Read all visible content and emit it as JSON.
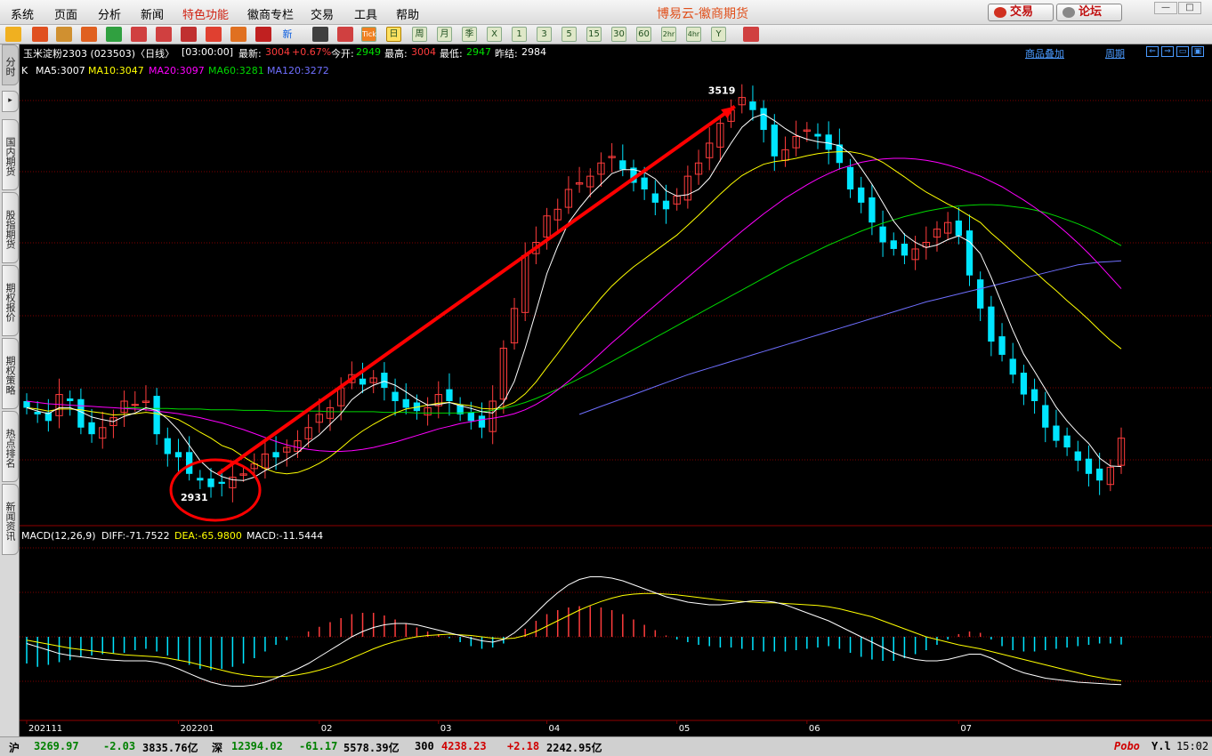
{
  "menu": {
    "items": [
      "系统",
      "页面",
      "分析",
      "新闻",
      "特色功能",
      "徽商专栏",
      "交易",
      "工具",
      "帮助"
    ],
    "app_title": "博易云-徽商期货",
    "trade_btn": "交易",
    "forum_btn": "论坛"
  },
  "toolbar": {
    "periods": [
      "日",
      "周",
      "月",
      "季",
      "X",
      "1",
      "3",
      "5",
      "15",
      "30",
      "60",
      "2hr",
      "4hr",
      "Y"
    ],
    "new_label": "新",
    "tick_label": "Tick"
  },
  "sidebar": {
    "tabs": [
      "分时",
      "国内期货",
      "股指期货",
      "期权报价",
      "期权策略",
      "热点排名",
      "新闻资讯"
    ]
  },
  "info": {
    "title": "玉米淀粉2303 (023503)〈日线〉",
    "time": "[03:00:00]",
    "latest_label": "最新:",
    "latest": "3004",
    "change": "+0.67%",
    "open_label": "今开:",
    "open": "2949",
    "high_label": "最高:",
    "high": "3004",
    "low_label": "最低:",
    "low": "2947",
    "prev_label": "昨结:",
    "prev": "2984",
    "overlay_link": "商品叠加",
    "period_link": "周期"
  },
  "ma_legend": {
    "k": "K",
    "ma5": "MA5:3007",
    "ma10": "MA10:3047",
    "ma20": "MA20:3097",
    "ma60": "MA60:3281",
    "ma120": "MA120:3272"
  },
  "macd_legend": {
    "name": "MACD(12,26,9)",
    "diff": "DIFF:-71.7522",
    "dea": "DEA:-65.9800",
    "macd": "MACD:-11.5444"
  },
  "annotations": {
    "high_label": "3519",
    "low_label": "2931"
  },
  "xaxis": {
    "labels": [
      "202111",
      "202201",
      "02",
      "03",
      "04",
      "05",
      "06",
      "07"
    ]
  },
  "colors": {
    "up": "#ff3c3c",
    "down": "#00e5ff",
    "ma5": "#ffffff",
    "ma10": "#ffff00",
    "ma20": "#ff00ff",
    "ma60": "#00d800",
    "ma120": "#6f6fff",
    "grid": "#800000",
    "arrow": "#ff0000"
  },
  "chart_data": {
    "type": "candlestick",
    "ylim": [
      2900,
      3540
    ],
    "closes": [
      3050,
      3040,
      3030,
      3070,
      3060,
      3020,
      3010,
      3020,
      3035,
      3060,
      3055,
      3060,
      3010,
      2980,
      2975,
      2950,
      2940,
      2930,
      2935,
      2945,
      2950,
      2965,
      2980,
      2975,
      2990,
      3000,
      3020,
      3040,
      3050,
      3080,
      3100,
      3085,
      3095,
      3080,
      3060,
      3050,
      3045,
      3050,
      3070,
      3060,
      3040,
      3030,
      3020,
      3060,
      3140,
      3200,
      3280,
      3300,
      3340,
      3350,
      3380,
      3390,
      3400,
      3420,
      3430,
      3410,
      3390,
      3380,
      3360,
      3350,
      3370,
      3400,
      3420,
      3450,
      3480,
      3500,
      3519,
      3500,
      3470,
      3430,
      3440,
      3460,
      3470,
      3460,
      3440,
      3420,
      3380,
      3360,
      3330,
      3300,
      3290,
      3280,
      3290,
      3300,
      3320,
      3330,
      3310,
      3250,
      3200,
      3150,
      3130,
      3100,
      3070,
      3060,
      3020,
      3000,
      2990,
      2970,
      2950,
      2940,
      2960,
      3004
    ],
    "ma5": [
      3050,
      3045,
      3041,
      3050,
      3050,
      3044,
      3036,
      3032,
      3029,
      3037,
      3042,
      3050,
      3046,
      3033,
      3016,
      2993,
      2970,
      2955,
      2946,
      2941,
      2940,
      2945,
      2955,
      2963,
      2972,
      2982,
      2997,
      3009,
      3025,
      3041,
      3062,
      3075,
      3084,
      3090,
      3084,
      3074,
      3063,
      3054,
      3055,
      3058,
      3053,
      3049,
      3044,
      3042,
      3058,
      3090,
      3140,
      3196,
      3253,
      3294,
      3330,
      3352,
      3372,
      3388,
      3404,
      3410,
      3410,
      3406,
      3396,
      3378,
      3370,
      3372,
      3380,
      3397,
      3424,
      3450,
      3474,
      3488,
      3494,
      3484,
      3472,
      3462,
      3456,
      3452,
      3450,
      3446,
      3434,
      3412,
      3388,
      3360,
      3332,
      3312,
      3300,
      3292,
      3296,
      3304,
      3310,
      3301,
      3283,
      3247,
      3207,
      3167,
      3131,
      3105,
      3078,
      3051,
      3030,
      3012,
      2996,
      2974,
      2962,
      2961
    ],
    "ma10": [
      3050,
      3048,
      3045,
      3048,
      3048,
      3047,
      3044,
      3042,
      3039,
      3040,
      3041,
      3043,
      3041,
      3037,
      3032,
      3023,
      3013,
      3004,
      2993,
      2987,
      2976,
      2966,
      2958,
      2952,
      2950,
      2952,
      2958,
      2966,
      2976,
      2989,
      3003,
      3015,
      3025,
      3034,
      3042,
      3048,
      3051,
      3054,
      3057,
      3058,
      3055,
      3053,
      3049,
      3048,
      3051,
      3058,
      3071,
      3089,
      3111,
      3132,
      3154,
      3176,
      3196,
      3216,
      3234,
      3249,
      3263,
      3275,
      3287,
      3299,
      3311,
      3326,
      3341,
      3357,
      3373,
      3388,
      3401,
      3410,
      3418,
      3422,
      3424,
      3427,
      3431,
      3434,
      3436,
      3437,
      3437,
      3434,
      3429,
      3421,
      3410,
      3399,
      3387,
      3376,
      3367,
      3358,
      3350,
      3340,
      3330,
      3314,
      3300,
      3285,
      3270,
      3256,
      3241,
      3227,
      3212,
      3198,
      3183,
      3167,
      3152,
      3139
    ],
    "ma20": [
      3060,
      3058,
      3056,
      3055,
      3054,
      3053,
      3052,
      3051,
      3050,
      3049,
      3048,
      3047,
      3045,
      3043,
      3041,
      3038,
      3035,
      3031,
      3027,
      3022,
      3017,
      3011,
      3005,
      2999,
      2994,
      2990,
      2987,
      2985,
      2984,
      2984,
      2985,
      2987,
      2990,
      2994,
      2998,
      3003,
      3008,
      3013,
      3018,
      3022,
      3026,
      3029,
      3032,
      3034,
      3037,
      3041,
      3047,
      3055,
      3065,
      3077,
      3090,
      3104,
      3118,
      3133,
      3148,
      3162,
      3177,
      3191,
      3205,
      3219,
      3233,
      3247,
      3261,
      3275,
      3289,
      3303,
      3317,
      3330,
      3343,
      3355,
      3367,
      3377,
      3387,
      3396,
      3404,
      3411,
      3416,
      3421,
      3424,
      3426,
      3427,
      3427,
      3426,
      3424,
      3421,
      3417,
      3412,
      3406,
      3400,
      3392,
      3384,
      3374,
      3364,
      3353,
      3341,
      3328,
      3314,
      3299,
      3283,
      3266,
      3248,
      3230
    ],
    "ma60": [
      null,
      null,
      null,
      null,
      null,
      null,
      null,
      null,
      null,
      3050,
      3050,
      3049,
      3049,
      3049,
      3048,
      3048,
      3048,
      3047,
      3047,
      3047,
      3046,
      3046,
      3046,
      3045,
      3045,
      3045,
      3045,
      3045,
      3044,
      3044,
      3044,
      3044,
      3044,
      3043,
      3043,
      3043,
      3042,
      3042,
      3042,
      3042,
      3042,
      3043,
      3044,
      3046,
      3049,
      3053,
      3058,
      3064,
      3071,
      3078,
      3086,
      3094,
      3102,
      3111,
      3120,
      3129,
      3138,
      3147,
      3156,
      3165,
      3174,
      3183,
      3192,
      3201,
      3210,
      3219,
      3228,
      3237,
      3246,
      3255,
      3264,
      3272,
      3280,
      3288,
      3296,
      3303,
      3310,
      3317,
      3323,
      3329,
      3334,
      3339,
      3343,
      3347,
      3350,
      3353,
      3355,
      3356,
      3357,
      3357,
      3356,
      3354,
      3352,
      3349,
      3345,
      3340,
      3334,
      3328,
      3321,
      3313,
      3304,
      3295
    ],
    "ma120": [
      null,
      null,
      null,
      null,
      null,
      null,
      null,
      null,
      null,
      null,
      null,
      null,
      null,
      null,
      null,
      null,
      null,
      null,
      null,
      null,
      null,
      null,
      null,
      null,
      null,
      null,
      null,
      null,
      null,
      null,
      null,
      null,
      null,
      null,
      null,
      null,
      null,
      null,
      null,
      null,
      null,
      null,
      null,
      null,
      null,
      null,
      null,
      null,
      null,
      null,
      null,
      3040,
      3046,
      3052,
      3058,
      3064,
      3070,
      3076,
      3082,
      3088,
      3094,
      3100,
      3105,
      3110,
      3115,
      3120,
      3125,
      3130,
      3135,
      3140,
      3145,
      3150,
      3155,
      3160,
      3165,
      3170,
      3175,
      3180,
      3185,
      3190,
      3195,
      3200,
      3205,
      3210,
      3214,
      3218,
      3222,
      3226,
      3230,
      3234,
      3238,
      3242,
      3246,
      3250,
      3254,
      3258,
      3262,
      3266,
      3268,
      3270,
      3271,
      3272
    ],
    "macd_hist": [
      -40,
      -45,
      -42,
      -38,
      -35,
      -30,
      -28,
      -26,
      -25,
      -24,
      -20,
      -18,
      -22,
      -28,
      -35,
      -42,
      -48,
      -50,
      -48,
      -45,
      -40,
      -32,
      -22,
      -12,
      -5,
      0,
      8,
      15,
      22,
      28,
      34,
      36,
      36,
      32,
      26,
      20,
      14,
      8,
      4,
      -2,
      -8,
      -14,
      -18,
      -16,
      -10,
      0,
      12,
      24,
      34,
      40,
      44,
      46,
      46,
      44,
      40,
      34,
      26,
      18,
      10,
      2,
      -4,
      -8,
      -12,
      -14,
      -16,
      -16,
      -18,
      -20,
      -22,
      -22,
      -22,
      -20,
      -18,
      -16,
      -14,
      -18,
      -24,
      -30,
      -34,
      -36,
      -36,
      -32,
      -26,
      -20,
      -12,
      -4,
      4,
      8,
      6,
      -4,
      -14,
      -20,
      -22,
      -22,
      -20,
      -18,
      -16,
      -14,
      -12,
      -10,
      -10,
      -11.5444
    ],
    "diff": [
      -10,
      -15,
      -20,
      -25,
      -28,
      -30,
      -32,
      -34,
      -35,
      -36,
      -36,
      -36,
      -38,
      -42,
      -48,
      -55,
      -62,
      -68,
      -72,
      -74,
      -74,
      -72,
      -68,
      -62,
      -55,
      -48,
      -40,
      -30,
      -20,
      -10,
      0,
      8,
      14,
      18,
      20,
      20,
      18,
      14,
      10,
      6,
      2,
      -2,
      -6,
      -8,
      -4,
      6,
      20,
      36,
      52,
      66,
      78,
      86,
      90,
      90,
      88,
      84,
      78,
      72,
      66,
      60,
      56,
      52,
      50,
      48,
      48,
      50,
      52,
      54,
      54,
      52,
      48,
      42,
      36,
      30,
      24,
      16,
      8,
      0,
      -8,
      -16,
      -24,
      -30,
      -34,
      -36,
      -36,
      -34,
      -30,
      -26,
      -26,
      -32,
      -40,
      -48,
      -54,
      -58,
      -62,
      -64,
      -66,
      -68,
      -69,
      -70,
      -71,
      -71.7522
    ],
    "dea": [
      -5,
      -8,
      -11,
      -14,
      -17,
      -19,
      -21,
      -23,
      -25,
      -27,
      -28,
      -29,
      -30,
      -32,
      -35,
      -38,
      -42,
      -46,
      -50,
      -54,
      -57,
      -59,
      -60,
      -60,
      -59,
      -57,
      -54,
      -50,
      -45,
      -39,
      -32,
      -25,
      -18,
      -12,
      -7,
      -3,
      0,
      2,
      3,
      4,
      3,
      2,
      0,
      -2,
      -3,
      -2,
      2,
      8,
      16,
      24,
      32,
      40,
      47,
      53,
      58,
      62,
      64,
      65,
      65,
      64,
      63,
      61,
      59,
      57,
      55,
      54,
      53,
      52,
      51,
      51,
      50,
      49,
      48,
      47,
      45,
      42,
      38,
      34,
      30,
      24,
      18,
      12,
      6,
      0,
      -4,
      -8,
      -12,
      -15,
      -18,
      -22,
      -26,
      -30,
      -34,
      -38,
      -42,
      -46,
      -50,
      -54,
      -58,
      -61,
      -64,
      -65.98
    ]
  }
}
